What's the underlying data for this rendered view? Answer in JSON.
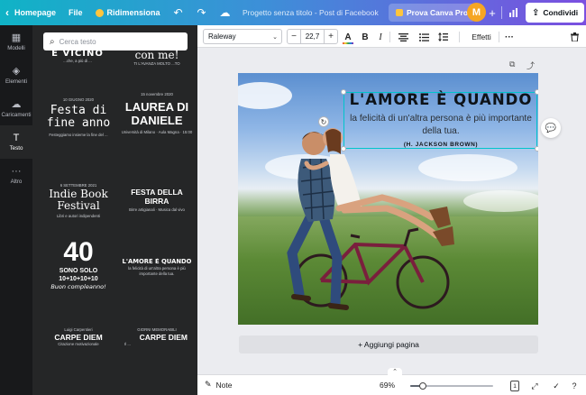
{
  "topbar": {
    "home": "Homepage",
    "file": "File",
    "resize": "Ridimensiona",
    "title": "Progetto senza titolo - Post di Facebook",
    "pro": "Prova Canva Pro",
    "avatar": "M",
    "share": "Condividi"
  },
  "rail": {
    "items": [
      {
        "label": "Modelli",
        "icon": "grid-icon",
        "glyph": "▦"
      },
      {
        "label": "Elementi",
        "icon": "shapes-icon",
        "glyph": "◈"
      },
      {
        "label": "Caricamenti",
        "icon": "cloud-upload-icon",
        "glyph": "☁"
      },
      {
        "label": "Testo",
        "icon": "text-icon",
        "glyph": "T"
      },
      {
        "label": "Altro",
        "icon": "more-dots-icon",
        "glyph": "···"
      }
    ],
    "active": "Testo"
  },
  "panel": {
    "search_placeholder": "Cerca testo",
    "templates": {
      "t1_big": "E VICINO",
      "t1_small": "...che, a più di ...",
      "t2_big": "con me!",
      "t2_small": "TI L'AVANZA MOLTO ...TO",
      "t3_date": "10 GIUGNO 2020",
      "t3_big": "Festa di fine anno",
      "t3_small": "Festeggiamo insieme la fine del ...",
      "t4_date": "15 novembre 2020",
      "t4_big": "LAUREA DI DANIELE",
      "t4_small": "Università di Milano · Aula Magna · 15:00",
      "t5_date": "6 SETTEMBRE 2021",
      "t5_big": "Indie Book Festival",
      "t5_small": "Libri e autori indipendenti",
      "t6_big": "FESTA DELLA BIRRA",
      "t6_small": "Birre artigianali · Musica dal vivo",
      "t7_big": "40",
      "t7_mid": "SONO SOLO",
      "t7_mid2": "10+10+10+10",
      "t7_small": "Buon compleanno!",
      "t8_big": "L'AMORE È QUANDO",
      "t8_small": "la felicità di un'altra persona è più importante della tua.",
      "t9_top": "Luigi Carpentieri",
      "t9_big": "CARPE DIEM",
      "t9_small": "Citazione motivazionale",
      "t10_top": "GIORNI MEMORABILI",
      "t10_big": "CARPE DIEM",
      "t10_small": "Il ..."
    }
  },
  "toolbar": {
    "font": "Raleway",
    "size_minus": "−",
    "size": "22,7",
    "size_plus": "+",
    "effects": "Effetti"
  },
  "design": {
    "heading": "L'AMORE È QUANDO",
    "body": "la felicità di un'altra persona è più importante della tua.",
    "author": "(H. JACKSON BROWN)"
  },
  "canvas": {
    "add_page": "+ Aggiungi pagina"
  },
  "bottombar": {
    "notes": "Note",
    "zoom": "69%",
    "zoom_level_percent": 15,
    "page_count": "1"
  },
  "colors": {
    "accent": "#00c4cc",
    "pro_crown": "#ffc53d",
    "avatar_bg": "#f5a623",
    "rail_bg": "#18191b",
    "panel_bg": "#252627"
  }
}
